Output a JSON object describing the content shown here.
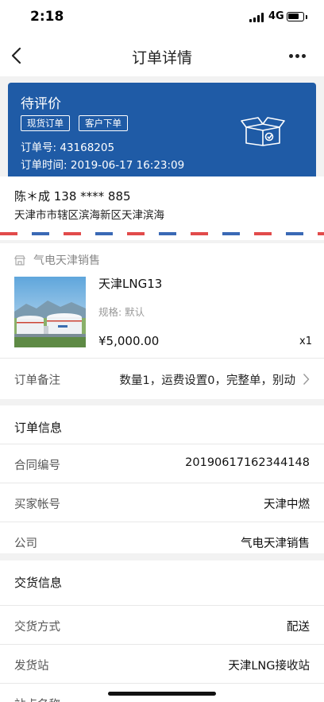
{
  "status_bar": {
    "time": "2:18",
    "network": "4G"
  },
  "nav": {
    "title": "订单详情"
  },
  "order": {
    "status": "待评价",
    "tags": [
      "现货订单",
      "客户下单"
    ],
    "order_no_label": "订单号:",
    "order_no": "43168205",
    "order_time_label": "订单时间:",
    "order_time": "2019-06-17 16:23:09"
  },
  "address": {
    "name_phone": "陈＊成 138 **** 885",
    "detail": "天津市市辖区滨海新区天津滨海"
  },
  "product": {
    "store": "气电天津销售",
    "name": "天津LNG13",
    "spec": "规格: 默认",
    "price": "¥5,000.00",
    "qty": "x1",
    "remark_label": "订单备注",
    "remark_value": "数量1，运费设置0，完整单，别动"
  },
  "order_info": {
    "title": "订单信息",
    "rows": [
      {
        "label": "合同编号",
        "value": "20190617162344148"
      },
      {
        "label": "买家帐号",
        "value": "天津中燃"
      },
      {
        "label": "公司",
        "value": "气电天津销售"
      }
    ]
  },
  "delivery_info": {
    "title": "交货信息",
    "rows": [
      {
        "label": "交货方式",
        "value": "配送"
      },
      {
        "label": "发货站",
        "value": "天津LNG接收站"
      },
      {
        "label": "站点名称",
        "value": ""
      }
    ]
  },
  "colors": {
    "card_blue": "#1f5ba6",
    "stripe_red": "#e24b4b",
    "stripe_blue": "#3a69b5"
  }
}
